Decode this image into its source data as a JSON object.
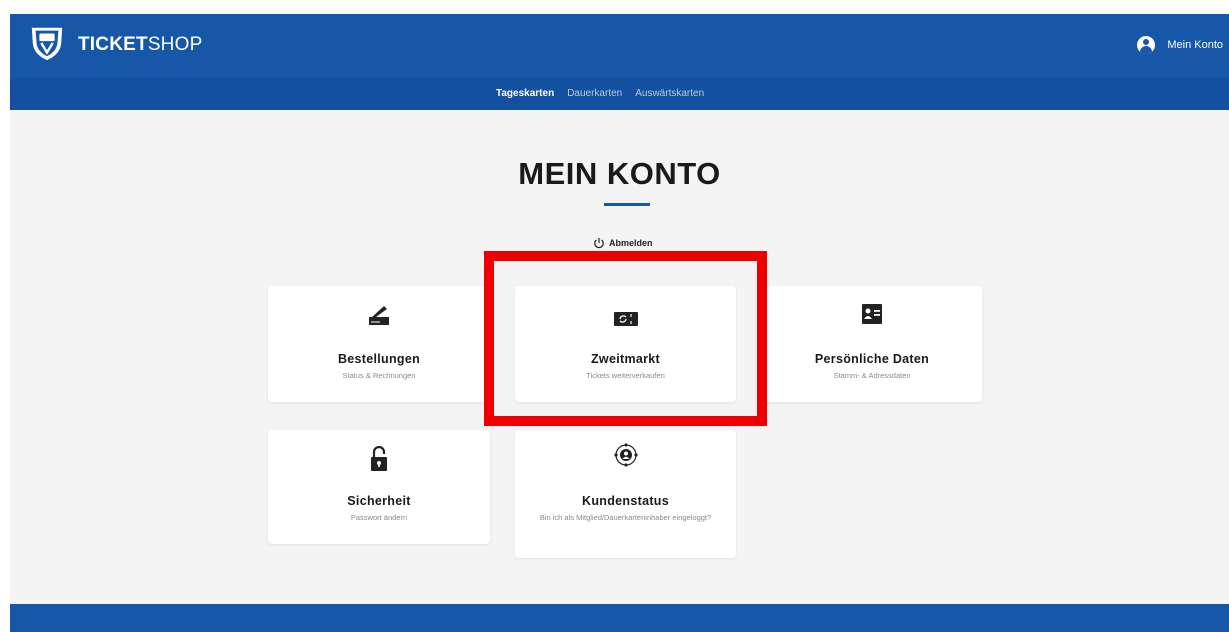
{
  "header": {
    "brand_bold": "TICKET",
    "brand_light": "SHOP",
    "account_label": "Mein Konto",
    "logo_icon": "club-shield-logo",
    "account_icon": "user-avatar-icon"
  },
  "subnav": {
    "items": [
      {
        "label": "Tageskarten",
        "active": true
      },
      {
        "label": "Dauerkarten",
        "active": false
      },
      {
        "label": "Auswärtskarten",
        "active": false
      }
    ]
  },
  "main": {
    "title": "MEIN KONTO",
    "logout_label": "Abmelden",
    "cards": [
      {
        "title": "Bestellungen",
        "subtitle": "Status & Rechnungen",
        "icon": "signature-pen-icon"
      },
      {
        "title": "Zweitmarkt",
        "subtitle": "Tickets weiterverkaufen",
        "icon": "ticket-exchange-icon"
      },
      {
        "title": "Persönliche Daten",
        "subtitle": "Stamm- & Adressdaten",
        "icon": "id-card-icon"
      },
      {
        "title": "Sicherheit",
        "subtitle": "Passwort ändern",
        "icon": "padlock-icon"
      },
      {
        "title": "Kundenstatus",
        "subtitle": "Bin ich als Mitglied/Dauerkarteninhaber eingeloggt?",
        "icon": "user-target-icon"
      }
    ]
  },
  "colors": {
    "primary": "#1657a8",
    "subnav": "#1450a0",
    "highlight": "#ee0000",
    "background": "#f4f4f4"
  }
}
